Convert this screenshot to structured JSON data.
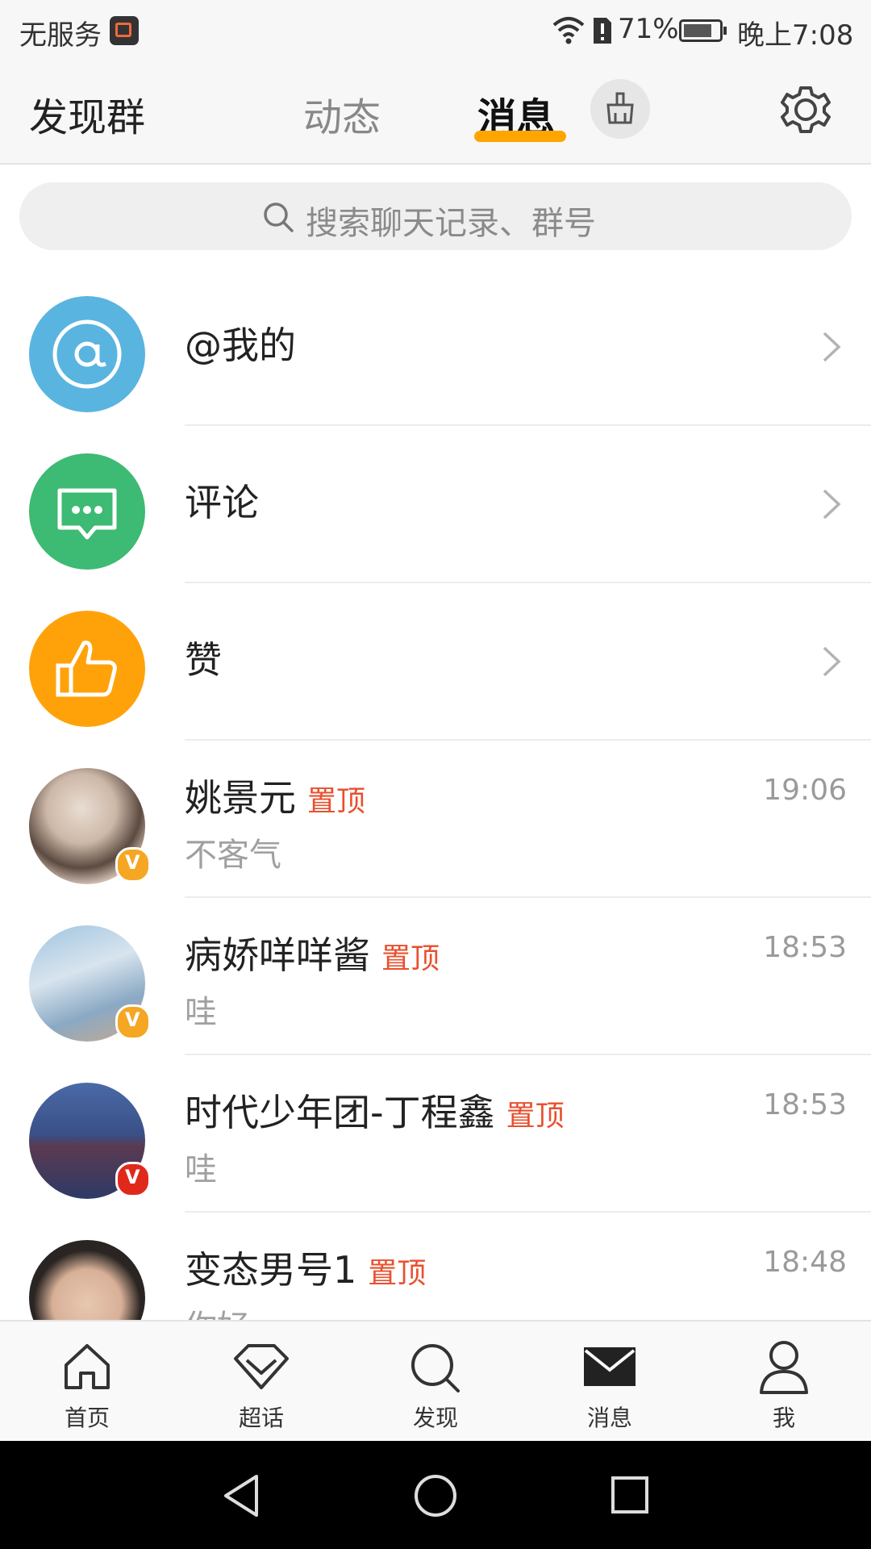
{
  "status_bar": {
    "carrier": "无服务",
    "battery": "71%",
    "time": "晚上7:08"
  },
  "header": {
    "discover_groups": "发现群",
    "tab_feed": "动态",
    "tab_messages": "消息",
    "active_tab": "消息",
    "accent_color": "#ffa500"
  },
  "search": {
    "placeholder": "搜索聊天记录、群号"
  },
  "notifications": [
    {
      "label": "@我的",
      "icon": "at-icon",
      "color": "#5ab4e0"
    },
    {
      "label": "评论",
      "icon": "comment-icon",
      "color": "#3dba73"
    },
    {
      "label": "赞",
      "icon": "thumbs-up-icon",
      "color": "#ffa20a"
    }
  ],
  "chats": [
    {
      "name": "姚景元",
      "tag": "置顶",
      "time": "19:06",
      "preview": "不客气",
      "badge": "V",
      "badge_color": "#f5a623"
    },
    {
      "name": "病娇咩咩酱",
      "tag": "置顶",
      "time": "18:53",
      "preview": "哇",
      "badge": "V",
      "badge_color": "#f5a623"
    },
    {
      "name": "时代少年团-丁程鑫",
      "tag": "置顶",
      "time": "18:53",
      "preview": "哇",
      "badge": "V",
      "badge_color": "#e0291b"
    },
    {
      "name": "变态男号1",
      "tag": "置顶",
      "time": "18:48",
      "preview": "你好",
      "badge": "",
      "badge_color": ""
    }
  ],
  "bottom_nav": [
    {
      "label": "首页",
      "icon": "home-icon"
    },
    {
      "label": "超话",
      "icon": "diamond-icon"
    },
    {
      "label": "发现",
      "icon": "search-icon"
    },
    {
      "label": "消息",
      "icon": "mail-icon"
    },
    {
      "label": "我",
      "icon": "user-icon"
    }
  ]
}
